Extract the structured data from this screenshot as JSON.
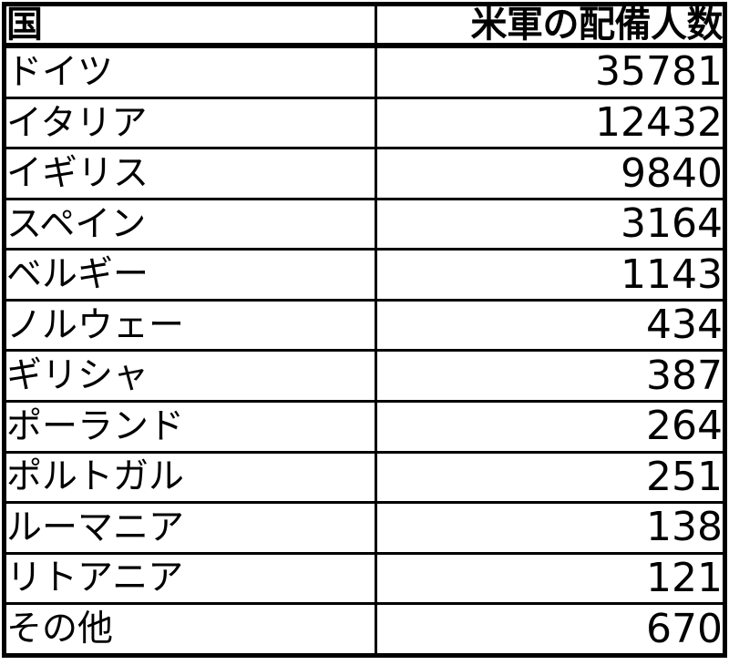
{
  "table": {
    "columns": [
      {
        "key": "country",
        "label": "国",
        "align": "left"
      },
      {
        "key": "value",
        "label": "米軍の配備人数",
        "align": "right"
      }
    ],
    "rows": [
      {
        "country": "ドイツ",
        "value": "35781"
      },
      {
        "country": "イタリア",
        "value": "12432"
      },
      {
        "country": "イギリス",
        "value": "9840"
      },
      {
        "country": "スペイン",
        "value": "3164"
      },
      {
        "country": "ベルギー",
        "value": "1143"
      },
      {
        "country": "ノルウェー",
        "value": "434"
      },
      {
        "country": "ギリシャ",
        "value": "387"
      },
      {
        "country": "ポーランド",
        "value": "264"
      },
      {
        "country": "ポルトガル",
        "value": "251"
      },
      {
        "country": "ルーマニア",
        "value": "138"
      },
      {
        "country": "リトアニア",
        "value": "121"
      },
      {
        "country": "その他",
        "value": "670"
      }
    ]
  },
  "chart_data": {
    "type": "table",
    "title": "",
    "columns": [
      "国",
      "米軍の配備人数"
    ],
    "categories": [
      "ドイツ",
      "イタリア",
      "イギリス",
      "スペイン",
      "ベルギー",
      "ノルウェー",
      "ギリシャ",
      "ポーランド",
      "ポルトガル",
      "ルーマニア",
      "リトアニア",
      "その他"
    ],
    "values": [
      35781,
      12432,
      9840,
      3164,
      1143,
      434,
      387,
      264,
      251,
      138,
      121,
      670
    ],
    "xlabel": "国",
    "ylabel": "米軍の配備人数"
  },
  "style": {
    "border_color": "#000000",
    "background_color": "#ffffff",
    "text_color": "#000000"
  }
}
